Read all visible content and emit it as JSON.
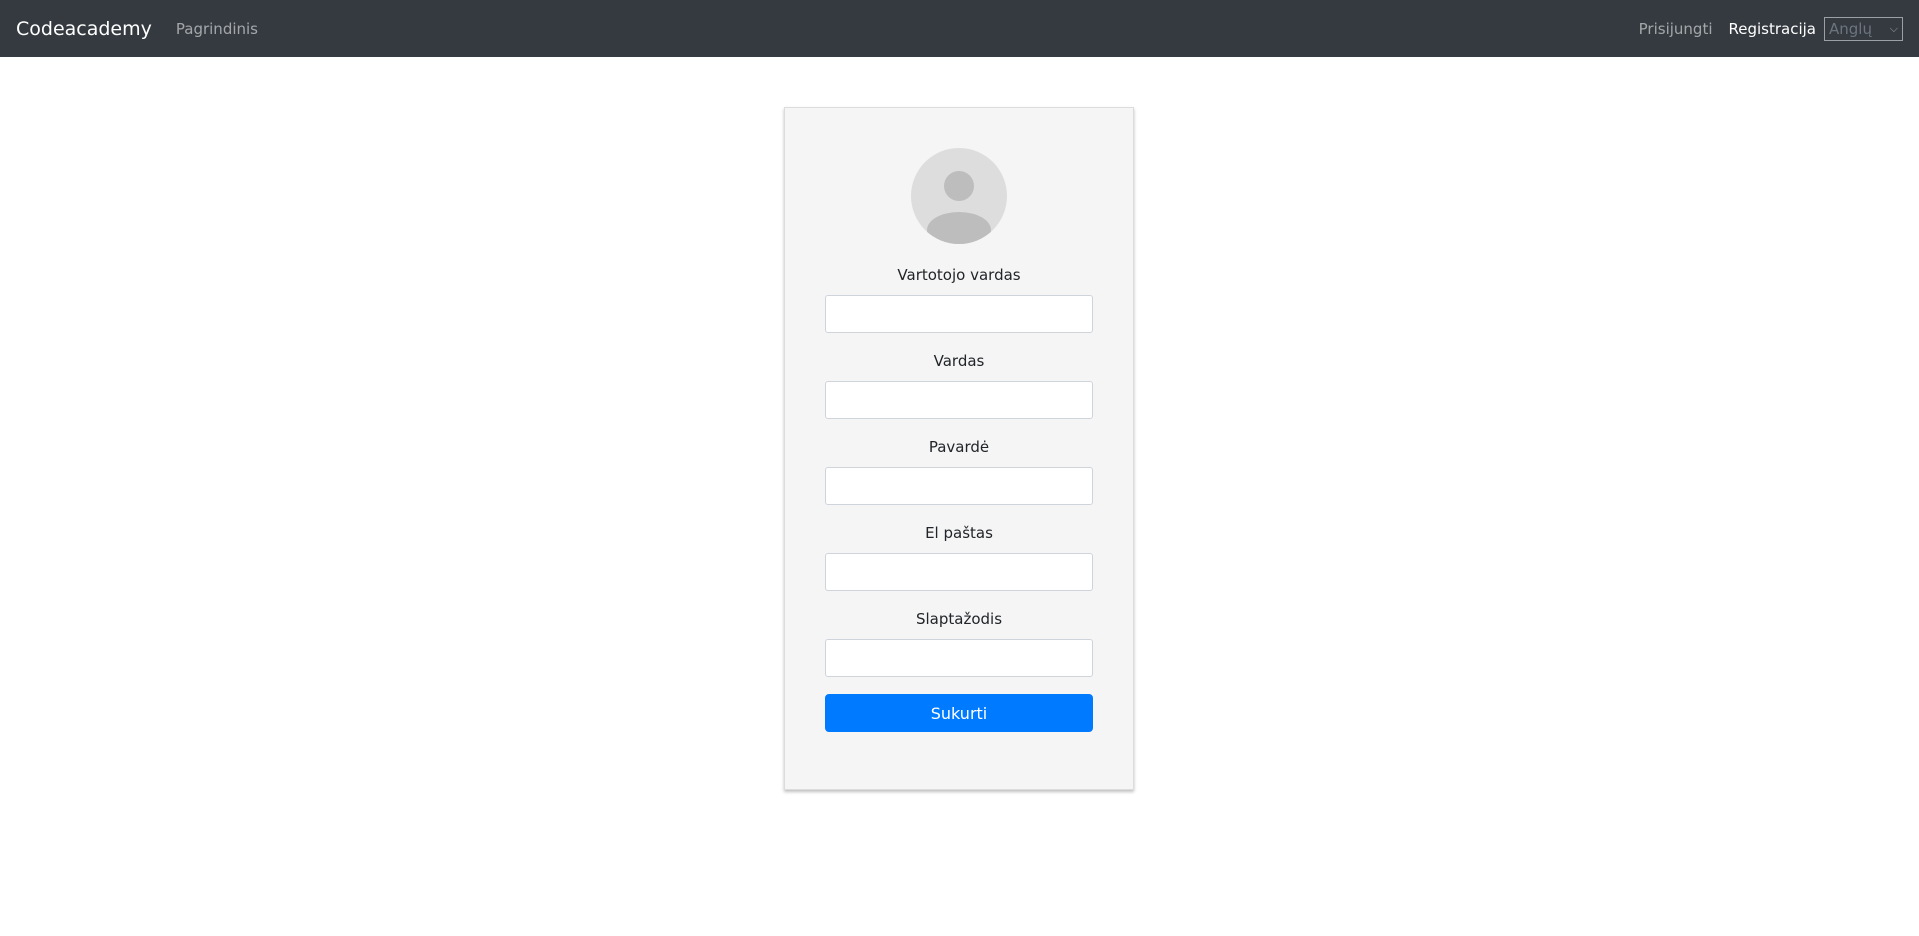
{
  "navbar": {
    "brand": "Codeacademy",
    "home_link": "Pagrindinis",
    "login_link": "Prisijungti",
    "register_link": "Registracija",
    "language_select": {
      "selected": "Anglų"
    }
  },
  "form": {
    "fields": [
      {
        "label": "Vartotojo vardas",
        "value": ""
      },
      {
        "label": "Vardas",
        "value": ""
      },
      {
        "label": "Pavardė",
        "value": ""
      },
      {
        "label": "El paštas",
        "value": ""
      },
      {
        "label": "Slaptažodis",
        "value": ""
      }
    ],
    "submit_label": "Sukurti"
  },
  "colors": {
    "navbar_bg": "#343a40",
    "primary": "#007bff",
    "card_bg": "#f5f5f5"
  }
}
